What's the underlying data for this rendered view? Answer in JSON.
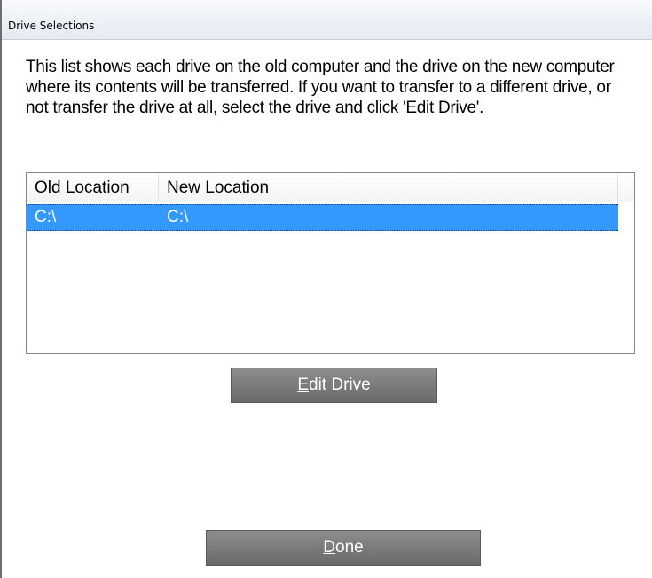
{
  "window": {
    "title": "Drive Selections"
  },
  "description": "This list shows each drive on the old computer and the drive on the new computer where its contents will be transferred. If you want to transfer to a different drive, or not transfer the drive at all, select the drive and click 'Edit Drive'.",
  "drive_list": {
    "columns": [
      "Old Location",
      "New Location"
    ],
    "rows": [
      {
        "old": "C:\\",
        "new": "C:\\"
      }
    ],
    "selected_row": 0
  },
  "buttons": {
    "edit_drive": {
      "mnemonic": "E",
      "rest": "dit Drive"
    },
    "done": {
      "mnemonic": "D",
      "rest": "one"
    }
  },
  "colors": {
    "selection": "#3399ff",
    "button": "#7a7a7a"
  }
}
